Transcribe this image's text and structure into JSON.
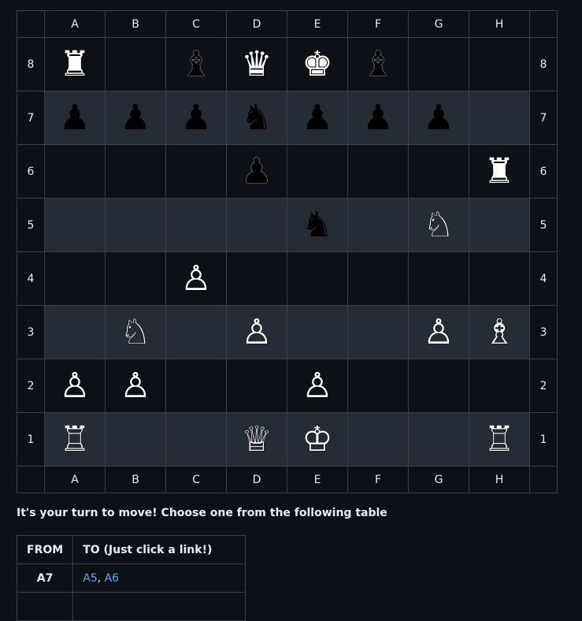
{
  "files": [
    "A",
    "B",
    "C",
    "D",
    "E",
    "F",
    "G",
    "H"
  ],
  "ranks": [
    "8",
    "7",
    "6",
    "5",
    "4",
    "3",
    "2",
    "1"
  ],
  "board": {
    "8": [
      {
        "glyph": "♜",
        "color": "white",
        "name": "black-rook-icon"
      },
      null,
      {
        "glyph": "♝",
        "color": "black",
        "name": "black-bishop-icon"
      },
      {
        "glyph": "♛",
        "color": "white",
        "name": "black-queen-icon"
      },
      {
        "glyph": "♚",
        "color": "white",
        "name": "black-king-icon"
      },
      {
        "glyph": "♝",
        "color": "black",
        "name": "black-bishop-icon"
      },
      null,
      null
    ],
    "7": [
      {
        "glyph": "♟",
        "color": "black",
        "name": "black-pawn-icon"
      },
      {
        "glyph": "♟",
        "color": "black",
        "name": "black-pawn-icon"
      },
      {
        "glyph": "♟",
        "color": "black",
        "name": "black-pawn-icon"
      },
      {
        "glyph": "♞",
        "color": "black",
        "name": "black-knight-icon"
      },
      {
        "glyph": "♟",
        "color": "black",
        "name": "black-pawn-icon"
      },
      {
        "glyph": "♟",
        "color": "black",
        "name": "black-pawn-icon"
      },
      {
        "glyph": "♟",
        "color": "black",
        "name": "black-pawn-icon"
      },
      null
    ],
    "6": [
      null,
      null,
      null,
      {
        "glyph": "♟",
        "color": "black",
        "name": "black-pawn-icon"
      },
      null,
      null,
      null,
      {
        "glyph": "♜",
        "color": "white",
        "name": "black-rook-icon"
      }
    ],
    "5": [
      null,
      null,
      null,
      null,
      {
        "glyph": "♞",
        "color": "black",
        "name": "black-knight-icon"
      },
      null,
      {
        "glyph": "♘",
        "color": "white",
        "name": "white-knight-icon"
      },
      null
    ],
    "4": [
      null,
      null,
      {
        "glyph": "♙",
        "color": "white",
        "name": "white-pawn-icon"
      },
      null,
      null,
      null,
      null,
      null
    ],
    "3": [
      null,
      {
        "glyph": "♘",
        "color": "white",
        "name": "white-knight-icon"
      },
      null,
      {
        "glyph": "♙",
        "color": "white",
        "name": "white-pawn-icon"
      },
      null,
      null,
      {
        "glyph": "♙",
        "color": "white",
        "name": "white-pawn-icon"
      },
      {
        "glyph": "♗",
        "color": "white",
        "name": "white-bishop-icon"
      }
    ],
    "2": [
      {
        "glyph": "♙",
        "color": "white",
        "name": "white-pawn-icon"
      },
      {
        "glyph": "♙",
        "color": "white",
        "name": "white-pawn-icon"
      },
      null,
      null,
      {
        "glyph": "♙",
        "color": "white",
        "name": "white-pawn-icon"
      },
      null,
      null,
      null
    ],
    "1": [
      {
        "glyph": "♖",
        "color": "white",
        "name": "white-rook-icon"
      },
      null,
      null,
      {
        "glyph": "♕",
        "color": "white",
        "name": "white-queen-icon"
      },
      {
        "glyph": "♔",
        "color": "white",
        "name": "white-king-icon"
      },
      null,
      null,
      {
        "glyph": "♖",
        "color": "white",
        "name": "white-rook-icon"
      }
    ]
  },
  "colors": {
    "light_square": "#0d1117",
    "dark_square": "#262c36",
    "link": "#58a6ff",
    "border": "#3a3f46"
  },
  "prompt": "It's your turn to move! Choose one from the following table",
  "moves_table": {
    "header_from": "FROM",
    "header_to": "TO (Just click a link!)",
    "rows": [
      {
        "from": "A7",
        "to": [
          "A5",
          "A6"
        ]
      },
      {
        "from": "",
        "to": []
      }
    ]
  }
}
